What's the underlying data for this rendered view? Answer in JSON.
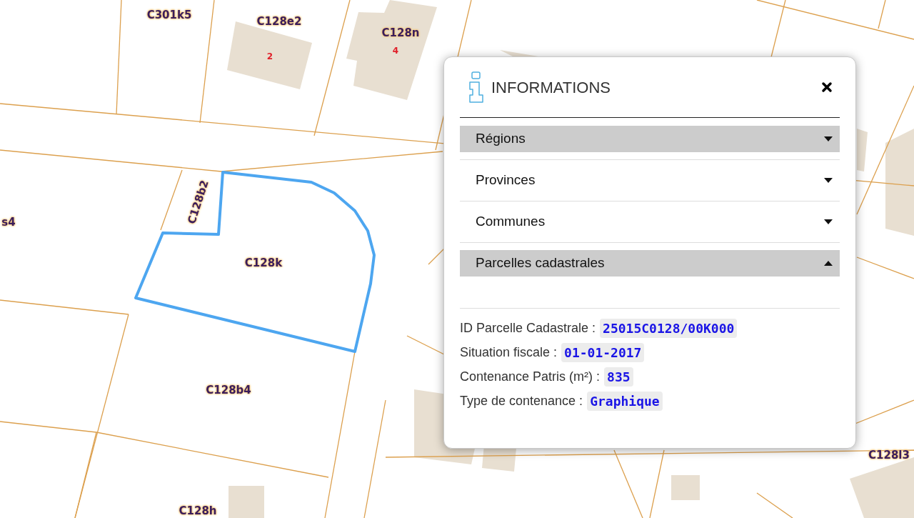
{
  "map": {
    "labels": [
      {
        "text": "C301k5",
        "kind": "parcel"
      },
      {
        "text": "C128e2",
        "kind": "parcel"
      },
      {
        "text": "2",
        "kind": "number"
      },
      {
        "text": "C128n",
        "kind": "parcel"
      },
      {
        "text": "4",
        "kind": "number"
      },
      {
        "text": "s4",
        "kind": "parcel"
      },
      {
        "text": "C128b2",
        "kind": "parcel"
      },
      {
        "text": "C128k",
        "kind": "parcel"
      },
      {
        "text": "C128b4",
        "kind": "parcel"
      },
      {
        "text": "C128h",
        "kind": "parcel"
      },
      {
        "text": "C128l3",
        "kind": "parcel"
      }
    ]
  },
  "popup": {
    "title": "INFORMATIONS",
    "sections": [
      {
        "label": "Régions",
        "expanded": false,
        "selected": true
      },
      {
        "label": "Provinces",
        "expanded": false,
        "selected": false
      },
      {
        "label": "Communes",
        "expanded": false,
        "selected": false
      },
      {
        "label": "Parcelles cadastrales",
        "expanded": true,
        "selected": true
      }
    ],
    "fields": [
      {
        "label": "ID Parcelle Cadastrale :",
        "value": "25015C0128/00K000"
      },
      {
        "label": "Situation fiscale :",
        "value": "01-01-2017"
      },
      {
        "label": "Contenance Patris (m²) :",
        "value": "835"
      },
      {
        "label": "Type de contenance :",
        "value": "Graphique"
      }
    ]
  }
}
